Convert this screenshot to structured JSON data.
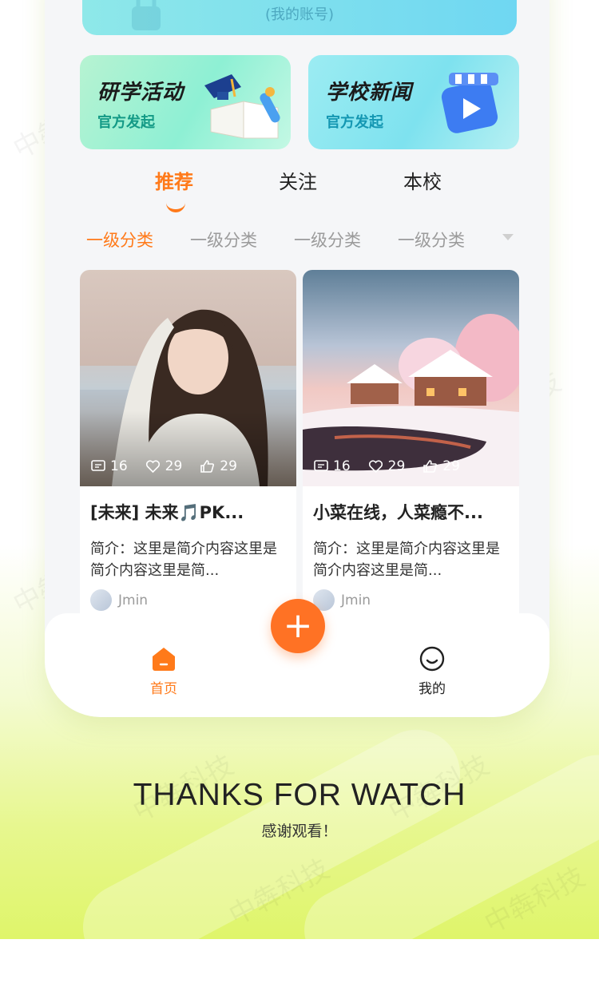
{
  "account": {
    "text": "(我的账号)"
  },
  "entries": [
    {
      "title": "研学活动",
      "subtitle": "官方发起"
    },
    {
      "title": "学校新闻",
      "subtitle": "官方发起"
    }
  ],
  "tabs": [
    {
      "label": "推荐",
      "active": true
    },
    {
      "label": "关注",
      "active": false
    },
    {
      "label": "本校",
      "active": false
    }
  ],
  "categories": [
    {
      "label": "一级分类",
      "active": true
    },
    {
      "label": "一级分类",
      "active": false
    },
    {
      "label": "一级分类",
      "active": false
    },
    {
      "label": "一级分类",
      "active": false
    }
  ],
  "posts": [
    {
      "comments": "16",
      "likes": "29",
      "thumbs": "29",
      "title": "[未来] 未来🎵PK...",
      "description": "简介：这里是简介内容这里是简介内容这里是简...",
      "author": "Jmin"
    },
    {
      "comments": "16",
      "likes": "29",
      "thumbs": "29",
      "title": "小菜在线，人菜瘾不...",
      "description": "简介：这里是简介内容这里是简介内容这里是简...",
      "author": "Jmin"
    }
  ],
  "tabbar": {
    "home_label": "首页",
    "add_label": "+",
    "mine_label": "我的"
  },
  "footer": {
    "title": "THANKS FOR WATCH",
    "subtitle": "感谢观看！"
  },
  "watermark": "中犇科技",
  "colors": {
    "accent": "#ff7a1a",
    "fab": "#ff7224"
  }
}
